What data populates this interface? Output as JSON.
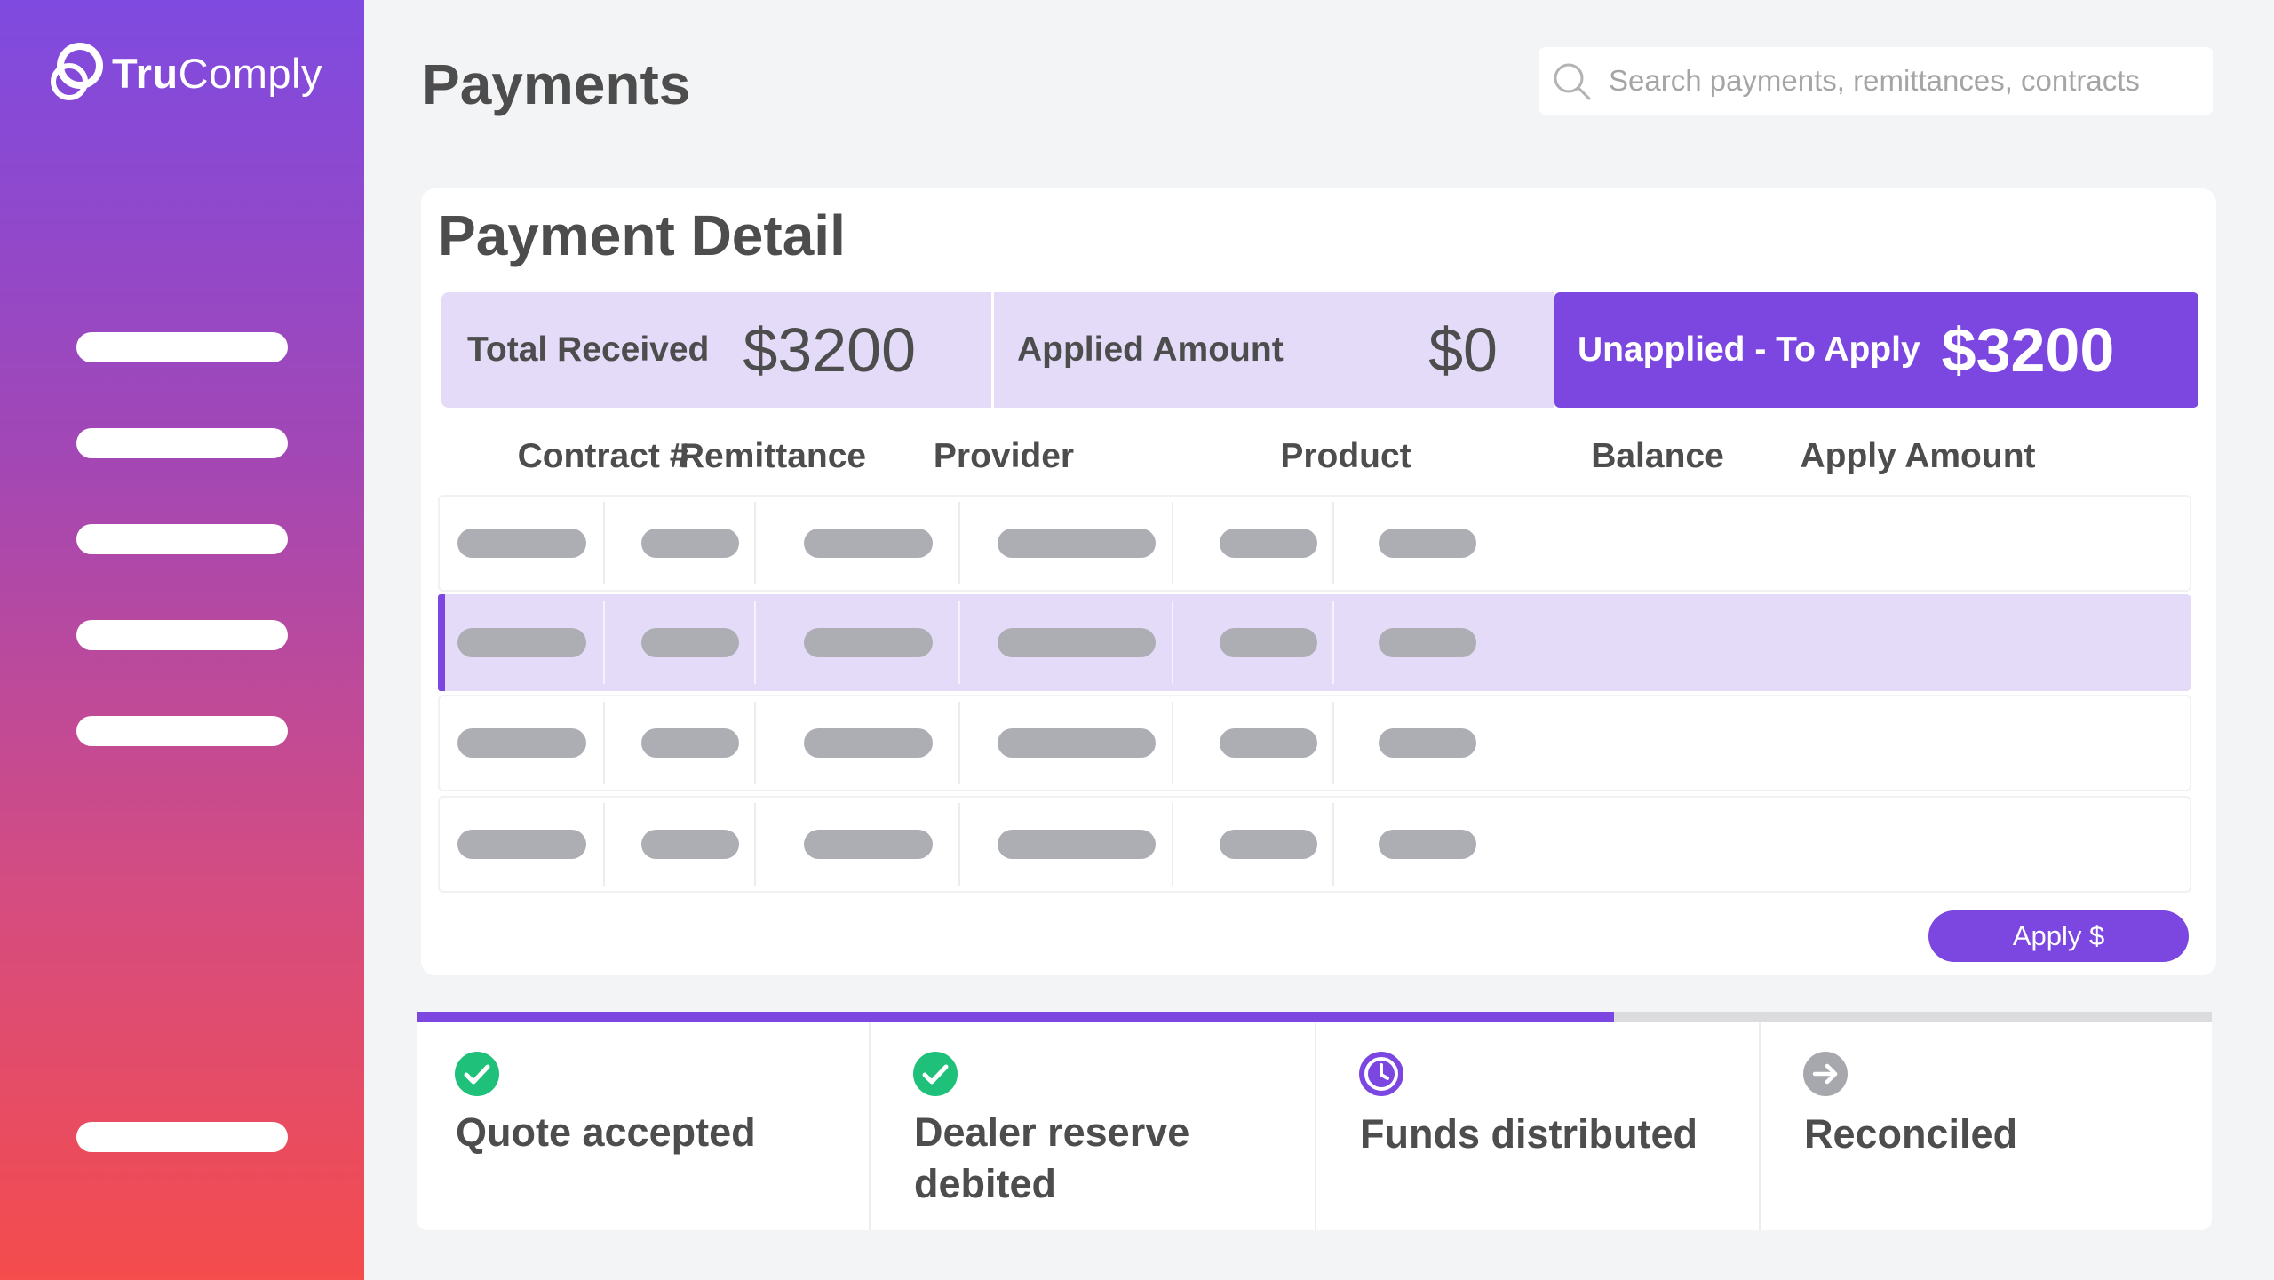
{
  "brand": {
    "name_bold": "Tru",
    "name_rest": "Comply"
  },
  "header": {
    "title": "Payments",
    "search_placeholder": "Search payments, remittances, contracts"
  },
  "card": {
    "title": "Payment Detail",
    "summary": {
      "total_received_label": "Total Received",
      "total_received_value": "$3200",
      "applied_label": "Applied Amount",
      "applied_value": "$0",
      "unapplied_label": "Unapplied - To Apply",
      "unapplied_value": "$3200"
    },
    "columns": [
      "Contract #",
      "Remittance",
      "Provider",
      "Product",
      "Balance",
      "Apply Amount"
    ],
    "row_count": 4,
    "selected_row": 2,
    "apply_button": "Apply $"
  },
  "steps": {
    "progress_percent": 66.7,
    "items": [
      {
        "label": "Quote accepted",
        "status": "complete",
        "icon": "check-circle-icon"
      },
      {
        "label": "Dealer reserve debited",
        "status": "complete",
        "icon": "check-circle-icon"
      },
      {
        "label": "Funds distributed",
        "status": "in-progress",
        "icon": "clock-icon"
      },
      {
        "label": "Reconciled",
        "status": "pending",
        "icon": "arrow-right-circle-icon"
      }
    ]
  },
  "colors": {
    "accent": "#7b47e0",
    "accent_light": "#e4dbf8",
    "success": "#1ec07a",
    "pending": "#a7a8ad"
  }
}
